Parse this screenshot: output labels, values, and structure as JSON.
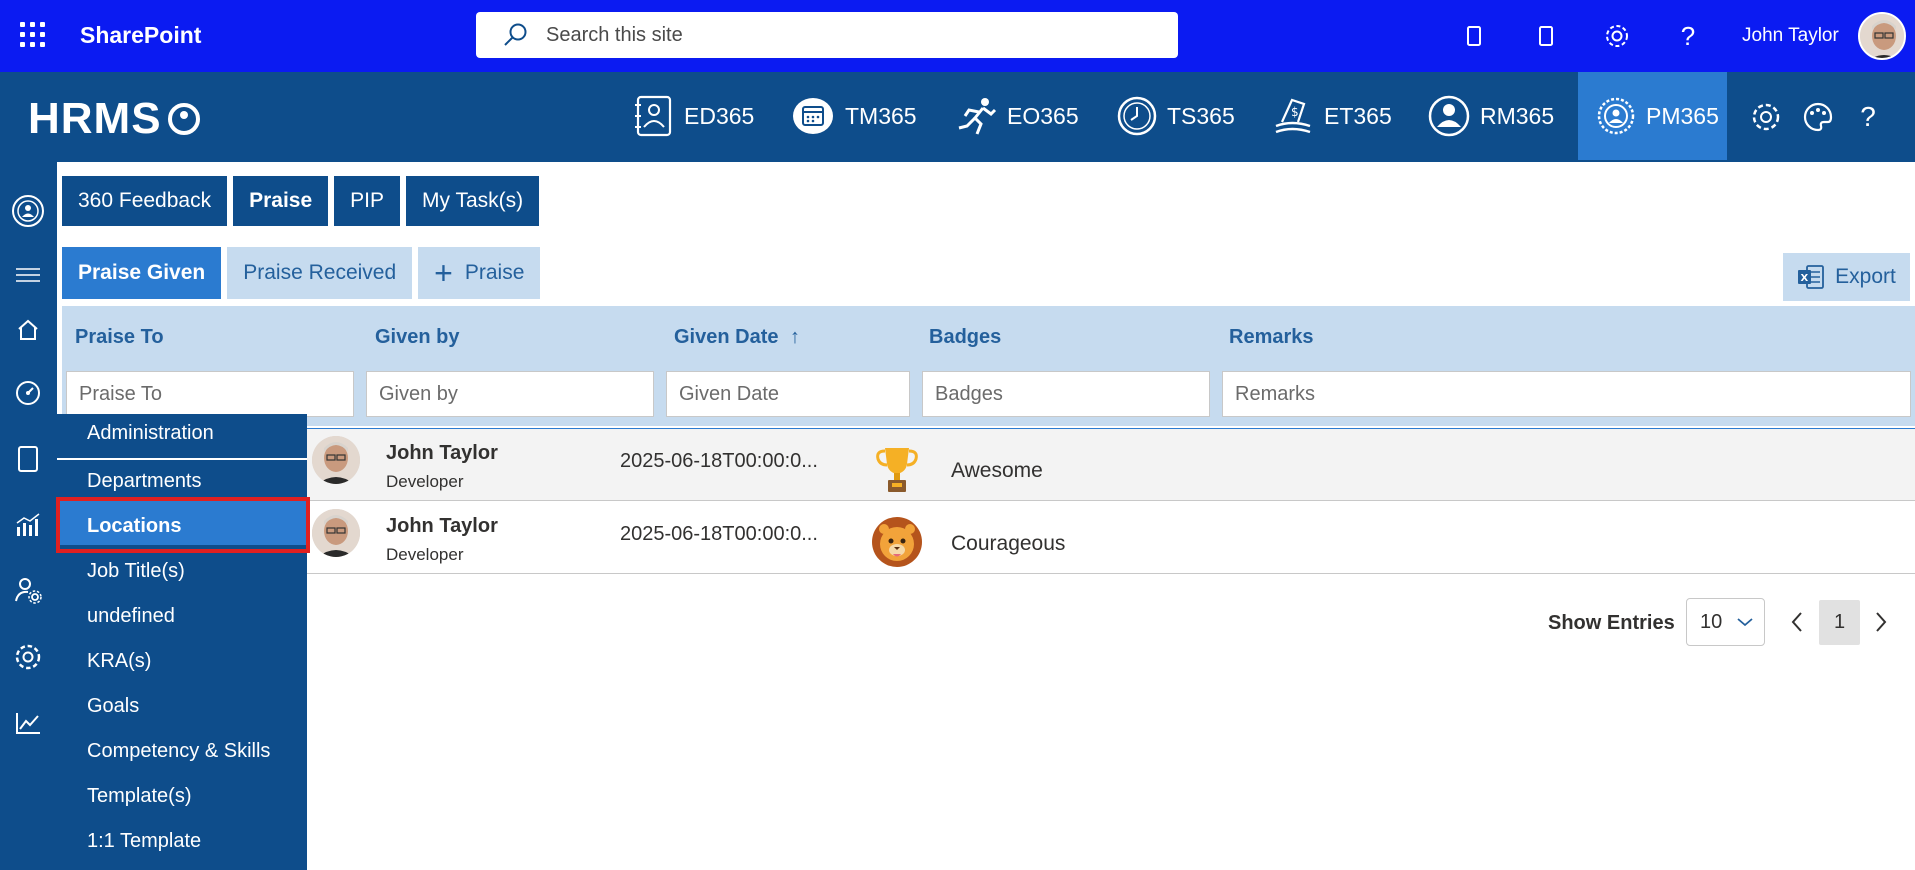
{
  "suitebar": {
    "app_name": "SharePoint",
    "search_placeholder": "Search this site",
    "user_name": "John Taylor",
    "icons": [
      "waffle-icon",
      "phone-icon",
      "tablet-icon",
      "gear-icon",
      "help-icon"
    ]
  },
  "hrms": {
    "logo_text": "HRMS",
    "modules": [
      {
        "label": "ED365",
        "icon": "employee-directory-icon"
      },
      {
        "label": "TM365",
        "icon": "calendar-icon"
      },
      {
        "label": "EO365",
        "icon": "onboarding-icon"
      },
      {
        "label": "TS365",
        "icon": "clock-icon"
      },
      {
        "label": "ET365",
        "icon": "expense-icon"
      },
      {
        "label": "RM365",
        "icon": "person-icon"
      },
      {
        "label": "PM365",
        "icon": "performance-icon",
        "active": true
      }
    ]
  },
  "tabs": [
    "360 Feedback",
    "Praise",
    "PIP",
    "My Task(s)"
  ],
  "subtabs": {
    "given": "Praise Given",
    "received": "Praise Received",
    "add": "Praise"
  },
  "export_label": "Export",
  "grid": {
    "columns": [
      "Praise To",
      "Given by",
      "Given Date",
      "Badges",
      "Remarks"
    ],
    "sort_indicator": "↑",
    "filters": [
      "Praise To",
      "Given by",
      "Given Date",
      "Badges",
      "Remarks"
    ],
    "rows": [
      {
        "name": "John Taylor",
        "role": "Developer",
        "date": "2025-06-18T00:00:0...",
        "badge": "Awesome",
        "badge_icon": "trophy-icon",
        "menu": "⋮"
      },
      {
        "name": "John Taylor",
        "role": "Developer",
        "date": "2025-06-18T00:00:0...",
        "badge": "Courageous",
        "badge_icon": "lion-icon"
      }
    ]
  },
  "pager": {
    "show_entries_label": "Show Entries",
    "page_size": "10",
    "current_page": "1"
  },
  "flyout": {
    "header": "Administration",
    "items": [
      "Departments",
      "Locations",
      "Job Title(s)",
      "undefined",
      "KRA(s)",
      "Goals",
      "Competency & Skills",
      "Template(s)",
      "1:1 Template"
    ],
    "selected": "Locations"
  },
  "colors": {
    "suitebar": "#0b1bf2",
    "brand": "#0e4d8b",
    "accent": "#2b7bd0",
    "light": "#c6dbef",
    "highlight_outline": "#e02020"
  }
}
